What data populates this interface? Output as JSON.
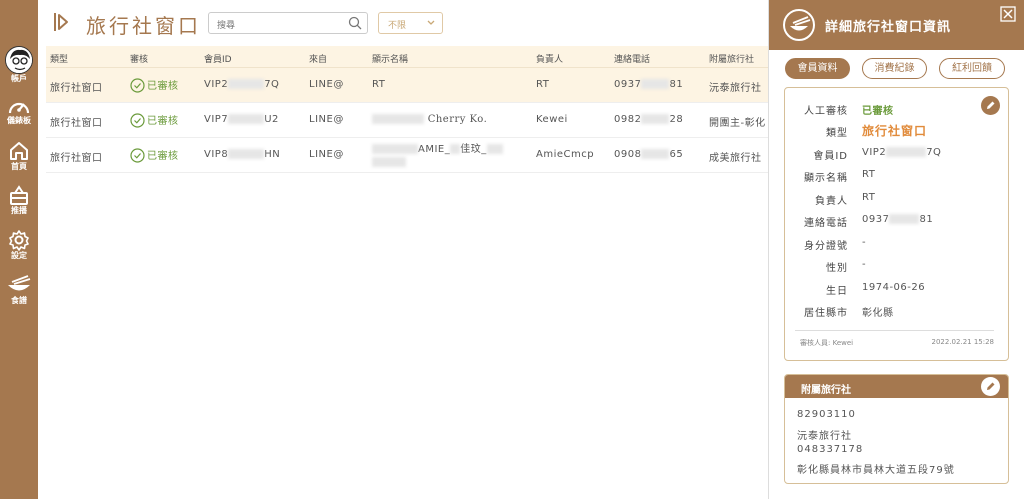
{
  "sidebar": {
    "items": [
      {
        "label": "帳戶",
        "icon": "user-avatar-icon"
      },
      {
        "label": "儀錶板",
        "icon": "dashboard-gauge-icon"
      },
      {
        "label": "首頁",
        "icon": "home-icon"
      },
      {
        "label": "推播",
        "icon": "broadcast-icon"
      },
      {
        "label": "設定",
        "icon": "gear-icon"
      },
      {
        "label": "食譜",
        "icon": "bowl-icon"
      }
    ]
  },
  "header": {
    "title": "旅行社窗口",
    "search_placeholder": "搜尋",
    "filter_value": "不限"
  },
  "table": {
    "columns": [
      "類型",
      "審核",
      "會員ID",
      "來自",
      "顯示名稱",
      "負責人",
      "連絡電話",
      "附屬旅行社"
    ],
    "rows": [
      {
        "type": "旅行社窗口",
        "status": "已審核",
        "id_a": "VIP2",
        "id_b": "7Q",
        "source": "LINE@",
        "name": "RT",
        "name2": "",
        "owner": "RT",
        "phone_a": "0937",
        "phone_b": "81",
        "agency": "沅泰旅行社"
      },
      {
        "type": "旅行社窗口",
        "status": "已審核",
        "id_a": "VIP7",
        "id_b": "U2",
        "source": "LINE@",
        "name": "Cherry Ko.",
        "name2": "",
        "owner": "Kewei",
        "phone_a": "0982",
        "phone_b": "28",
        "agency": "開團主-彰化"
      },
      {
        "type": "旅行社窗口",
        "status": "已審核",
        "id_a": "VIP8",
        "id_b": "HN",
        "source": "LINE@",
        "name": "AMIE_",
        "name2": "佳玟_",
        "owner": "AmieCmcp",
        "phone_a": "0908",
        "phone_b": "65",
        "agency": "成美旅行社"
      }
    ]
  },
  "panel": {
    "title": "詳細旅行社窗口資訊",
    "tabs": [
      "會員資料",
      "消費紀錄",
      "紅利回饋"
    ],
    "fields": [
      {
        "label": "人工審核",
        "value": "已審核"
      },
      {
        "label": "類型",
        "value": "旅行社窗口"
      },
      {
        "label": "會員ID",
        "value_a": "VIP2",
        "value_b": "7Q"
      },
      {
        "label": "顯示名稱",
        "value": "RT"
      },
      {
        "label": "負責人",
        "value": "RT"
      },
      {
        "label": "連絡電話",
        "value_a": "0937",
        "value_b": "81"
      },
      {
        "label": "身分證號",
        "value": "-"
      },
      {
        "label": "性別",
        "value": "-"
      },
      {
        "label": "生日",
        "value": "1974-06-26"
      },
      {
        "label": "居住縣市",
        "value": "彰化縣"
      }
    ],
    "reviewer": "審核人員: Kewei",
    "review_time": "2022.02.21 15:28",
    "agency_card": {
      "title": "附屬旅行社",
      "lines": [
        "82903110",
        "沅泰旅行社",
        "048337178",
        "彰化縣員林市員林大道五段79號"
      ]
    }
  },
  "colors": {
    "brand": "#a5784f",
    "highlight": "#fdf4e3",
    "verified": "#6a9a3a",
    "type_accent": "#e18b3b"
  }
}
